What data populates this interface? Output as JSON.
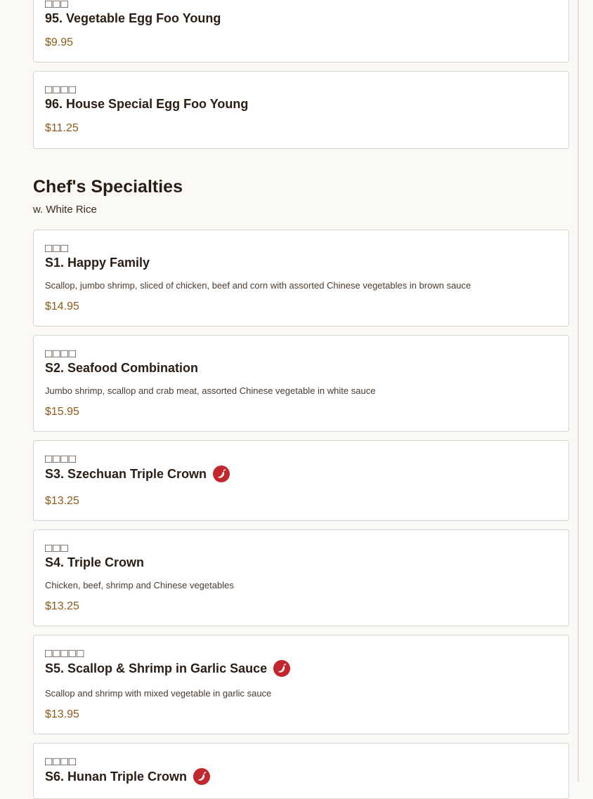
{
  "menu": {
    "egg_foo_young": {
      "items": [
        {
          "cjk": "□□□",
          "name": "95. Vegetable Egg Foo Young",
          "price": "$9.95"
        },
        {
          "cjk": "□□□□",
          "name": "96. House Special Egg Foo Young",
          "price": "$11.25"
        }
      ]
    },
    "chefs_specialties": {
      "title": "Chef's Specialties",
      "subtitle": "w. White Rice",
      "items": [
        {
          "cjk": "□□□",
          "name": "S1. Happy Family",
          "description": "Scallop, jumbo shrimp, sliced of chicken, beef and corn with assorted Chinese vegetables in brown sauce",
          "price": "$14.95",
          "spicy": false
        },
        {
          "cjk": "□□□□",
          "name": "S2. Seafood Combination",
          "description": "Jumbo shrimp, scallop and crab meat, assorted Chinese vegetable in white sauce",
          "price": "$15.95",
          "spicy": false
        },
        {
          "cjk": "□□□□",
          "name": "S3. Szechuan Triple Crown",
          "price": "$13.25",
          "spicy": true
        },
        {
          "cjk": "□□□",
          "name": "S4. Triple Crown",
          "description": "Chicken, beef, shrimp and Chinese vegetables",
          "price": "$13.25",
          "spicy": false
        },
        {
          "cjk": "□□□□□",
          "name": "S5. Scallop & Shrimp in Garlic Sauce",
          "description": "Scallop and shrimp with mixed vegetable in garlic sauce",
          "price": "$13.95",
          "spicy": true
        },
        {
          "cjk": "□□□□",
          "name": "S6. Hunan Triple Crown",
          "spicy": true
        }
      ]
    }
  },
  "icons": {
    "spicy": "chili-pepper-icon"
  },
  "colors": {
    "price": "#8b5a1a",
    "spicy_badge": "#c1272d",
    "text": "#2b1d14",
    "card_border": "#d8d5cf",
    "background": "#faf9f6"
  }
}
